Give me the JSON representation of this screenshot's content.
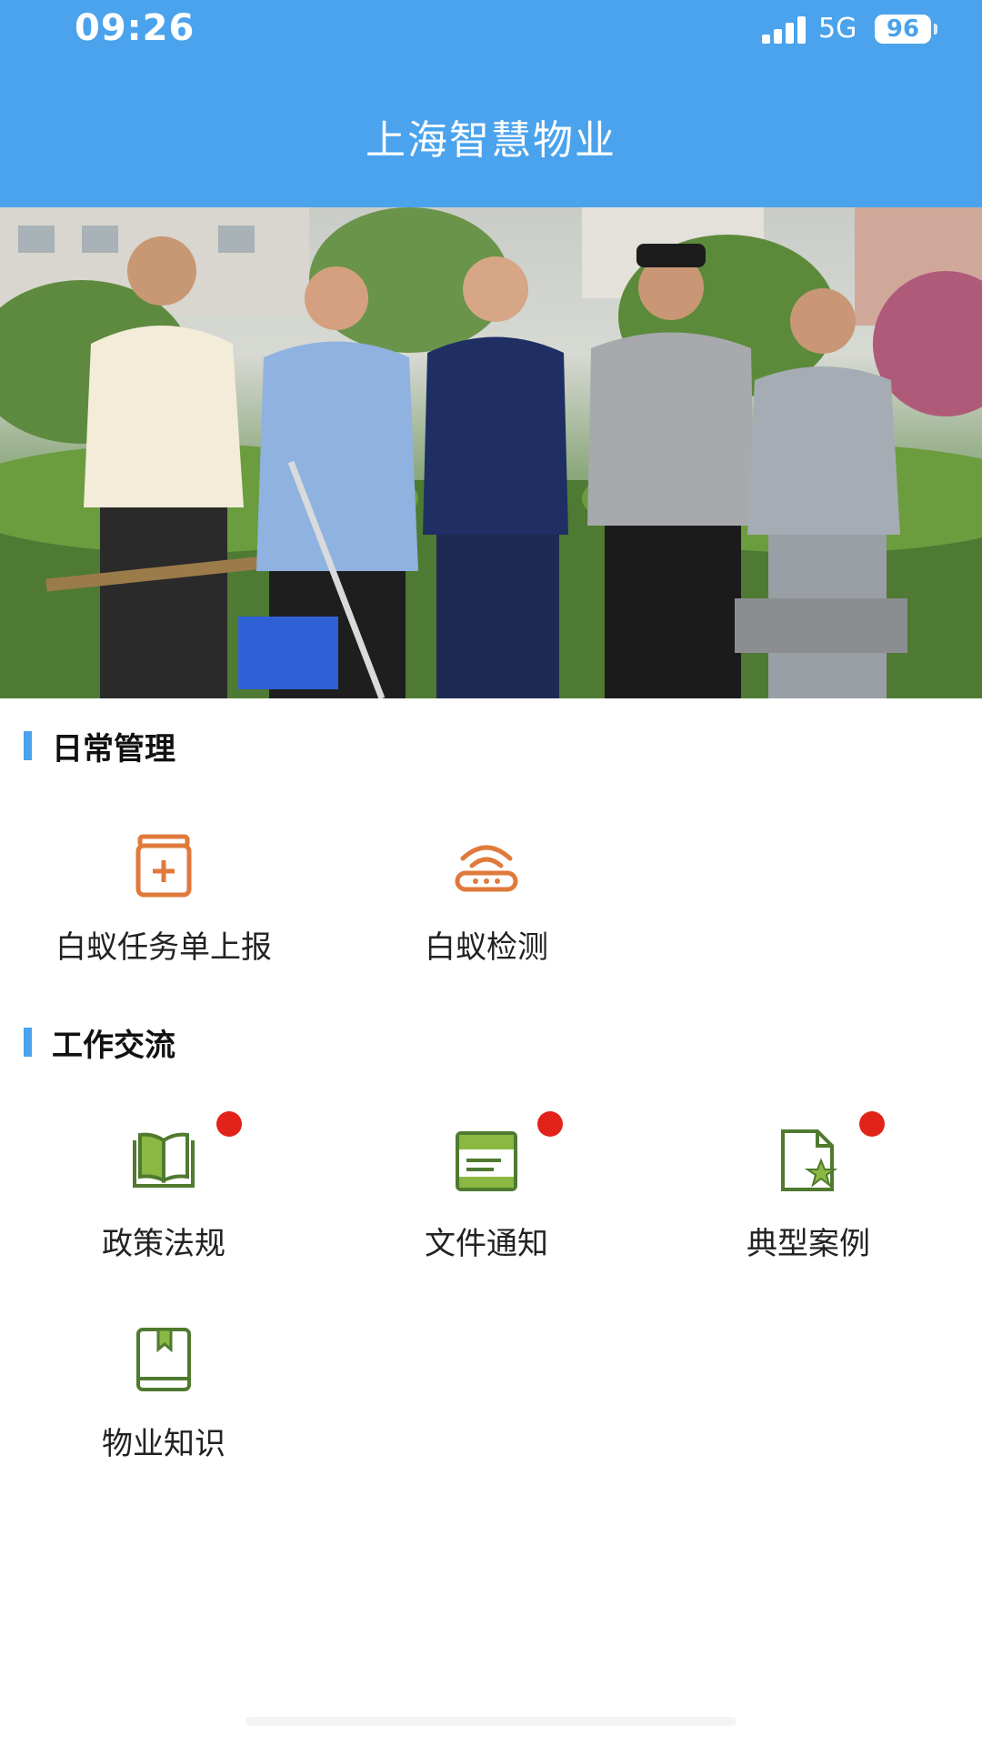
{
  "status_bar": {
    "time": "09:26",
    "network": "5G",
    "battery": "96"
  },
  "header": {
    "title": "上海智慧物业"
  },
  "banner": {
    "icon": "photo-staff-group"
  },
  "sections": [
    {
      "title": "日常管理",
      "items": [
        {
          "label": "白蚁任务单上报",
          "icon": "task-report-icon"
        },
        {
          "label": "白蚁检测",
          "icon": "router-detect-icon"
        }
      ]
    },
    {
      "title": "工作交流",
      "items": [
        {
          "label": "政策法规",
          "icon": "open-book-icon",
          "badge": true
        },
        {
          "label": "文件通知",
          "icon": "document-icon",
          "badge": true
        },
        {
          "label": "典型案例",
          "icon": "star-file-icon",
          "badge": true
        },
        {
          "label": "物业知识",
          "icon": "bookmark-book-icon",
          "badge": false
        }
      ]
    }
  ],
  "colors": {
    "accent": "#4aa3ec",
    "orange_icon": "#e07a3c",
    "green_icon": "#4f7a2f",
    "badge": "#e2231a"
  }
}
